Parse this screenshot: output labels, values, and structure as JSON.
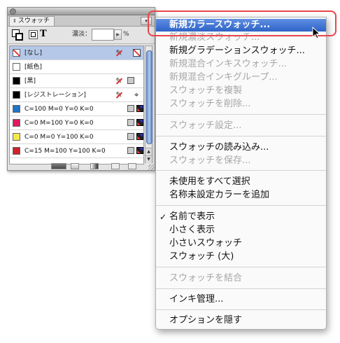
{
  "panel": {
    "tab_label": "スウォッチ",
    "tab_arrows": "⇕",
    "menu_button_glyph": "▾",
    "tint_label": "濃淡：",
    "tint_value": "",
    "tint_unit": "%",
    "text_mode_glyph": "T",
    "swatches": [
      {
        "name": "[なし]",
        "color": "none",
        "selected": true
      },
      {
        "name": "[紙色]",
        "color": "#ffffff"
      },
      {
        "name": "[黒]",
        "color": "#000000"
      },
      {
        "name": "[レジストレーション]",
        "color": "#000000"
      },
      {
        "name": "C=100 M=0 Y=0 K=0",
        "color": "#1f74c9"
      },
      {
        "name": "C=0 M=100 Y=0 K=0",
        "color": "#e0185f"
      },
      {
        "name": "C=0 M=0 Y=100 K=0",
        "color": "#f5e84b"
      },
      {
        "name": "C=15 M=100 Y=100 K=0",
        "color": "#d0202a"
      }
    ]
  },
  "menu": {
    "items": [
      {
        "label": "新規カラースウォッチ...",
        "state": "active"
      },
      {
        "label": "新規濃淡スウォッチ...",
        "state": "disabled"
      },
      {
        "label": "新規グラデーションスウォッチ...",
        "state": "enabled"
      },
      {
        "label": "新規混合インキスウォッチ...",
        "state": "disabled"
      },
      {
        "label": "新規混合インキグループ...",
        "state": "disabled"
      },
      {
        "label": "スウォッチを複製",
        "state": "disabled"
      },
      {
        "label": "スウォッチを削除...",
        "state": "disabled"
      },
      {
        "label": "スウォッチ設定...",
        "state": "disabled"
      },
      {
        "label": "スウォッチの読み込み...",
        "state": "enabled"
      },
      {
        "label": "スウォッチを保存...",
        "state": "disabled"
      },
      {
        "label": "未使用をすべて選択",
        "state": "enabled"
      },
      {
        "label": "名称未設定カラーを追加",
        "state": "enabled"
      },
      {
        "label": "名前で表示",
        "state": "enabled",
        "checked": true
      },
      {
        "label": "小さく表示",
        "state": "enabled"
      },
      {
        "label": "小さいスウォッチ",
        "state": "enabled"
      },
      {
        "label": "スウォッチ (大)",
        "state": "enabled"
      },
      {
        "label": "スウォッチを結合",
        "state": "disabled"
      },
      {
        "label": "インキ管理...",
        "state": "enabled"
      },
      {
        "label": "オプションを隠す",
        "state": "enabled"
      }
    ],
    "check_glyph": "✓"
  },
  "colors": {
    "menu_highlight": "#2e63c7",
    "callout_ring": "#e8454a",
    "selected_row": "#b5c8e8"
  },
  "icons": {
    "fill_stroke": "fill-stroke-icon",
    "container": "container-icon",
    "no_change": "pencil-crossed-icon",
    "registration": "registration-mark-icon",
    "spot": "spot-color-icon",
    "cmyk": "cmyk-mode-icon"
  }
}
